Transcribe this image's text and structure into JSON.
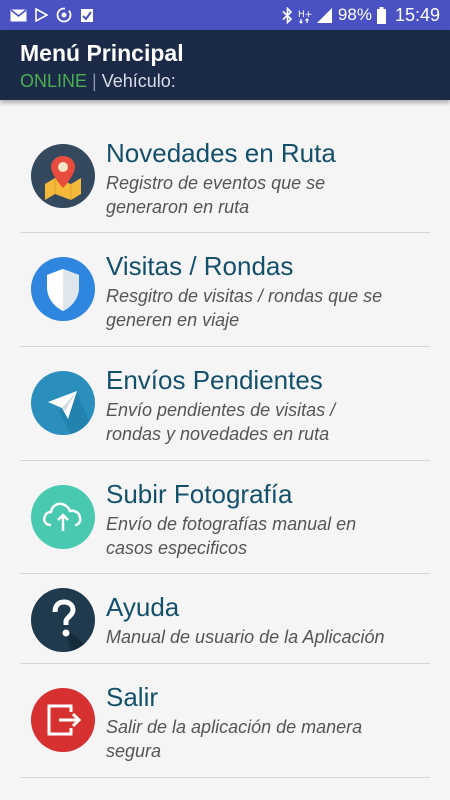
{
  "status_bar": {
    "battery_percent": "98%",
    "time": "15:49",
    "left_icons": [
      "mail-icon",
      "play-icon",
      "sync-icon",
      "flag-icon"
    ],
    "right_icons": [
      "bluetooth-icon",
      "hplus-icon",
      "signal-icon",
      "battery-icon"
    ]
  },
  "header": {
    "title": "Menú Principal",
    "status": "ONLINE",
    "separator": "|",
    "vehicle_label": "Vehículo:"
  },
  "menu": {
    "items": [
      {
        "title": "Novedades en Ruta",
        "description_line1": "Registro de eventos que se",
        "description_line2": "generaron en ruta",
        "icon": "map-pin-icon",
        "color": "#34495e"
      },
      {
        "title": "Visitas / Rondas",
        "description_line1": "Resgitro de visitas / rondas que se",
        "description_line2": "generen en viaje",
        "icon": "shield-icon",
        "color": "#2e86de"
      },
      {
        "title": "Envíos Pendientes",
        "description_line1": "Envío pendientes de visitas /",
        "description_line2": "rondas y novedades en ruta",
        "icon": "paper-plane-icon",
        "color": "#2a8fbd"
      },
      {
        "title": "Subir Fotografía",
        "description_line1": "Envío de fotografías manual en",
        "description_line2": "casos especificos",
        "icon": "cloud-upload-icon",
        "color": "#48c9b0"
      },
      {
        "title": "Ayuda",
        "description_line1": "Manual de usuario de la Aplicación",
        "description_line2": "",
        "icon": "help-icon",
        "color": "#1f3a4d"
      },
      {
        "title": "Salir",
        "description_line1": "Salir de la aplicación de manera",
        "description_line2": "segura",
        "icon": "exit-icon",
        "color": "#d63031"
      }
    ]
  },
  "colors": {
    "status_bar_bg": "#4a52c3",
    "app_bar_bg": "#1b2a47",
    "online_green": "#4caf50",
    "title_teal": "#15506a",
    "page_bg": "#f5f5f5"
  }
}
